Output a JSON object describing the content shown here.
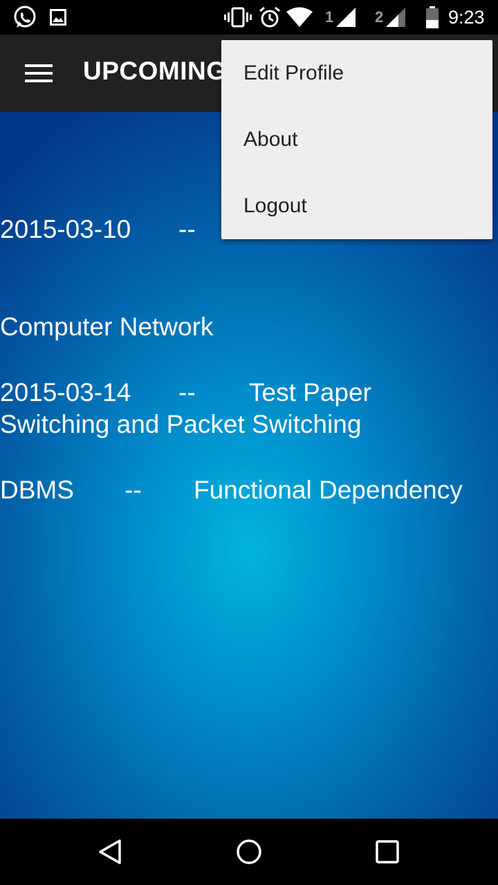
{
  "status_bar": {
    "time": "9:23",
    "sim1": "1",
    "sim2": "2",
    "icons": [
      "whatsapp-icon",
      "image-icon",
      "vibrate-icon",
      "alarm-icon",
      "wifi-icon",
      "signal-icon",
      "battery-icon"
    ]
  },
  "toolbar": {
    "title": "UPCOMING",
    "menu_icon": "hamburger-menu-icon"
  },
  "entries": [
    {
      "date": "2015-03-10",
      "sep1": "--",
      "line2": "Computer Network",
      "line3": "Switching and Packet Switching"
    },
    {
      "date": "2015-03-14",
      "sep1": "--",
      "type": "Test Paper",
      "subject": "DBMS",
      "sep2": "--",
      "topic": "Functional Dependency"
    }
  ],
  "menu": {
    "items": [
      {
        "label": "Edit Profile"
      },
      {
        "label": "About"
      },
      {
        "label": "Logout"
      }
    ]
  },
  "nav": {
    "icons": [
      "back-icon",
      "home-icon",
      "recents-icon"
    ]
  }
}
